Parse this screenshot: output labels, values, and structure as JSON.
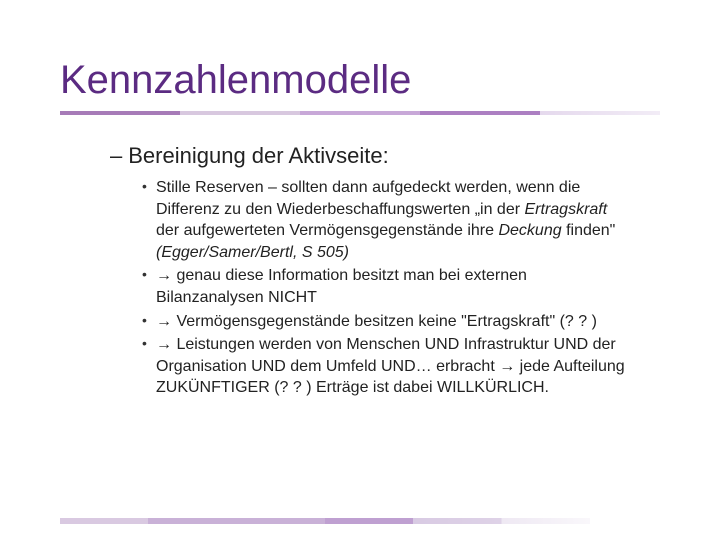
{
  "title": "Kennzahlenmodelle",
  "subheading": "Bereinigung der Aktivseite:",
  "items": [
    {
      "pre": "Stille Reserven – sollten dann aufgedeckt werden, wenn die Differenz zu den Wiederbeschaffungswerten „in der ",
      "em1": "Ertragskraft",
      "mid": " der aufgewerteten Vermögensgegenstände ihre ",
      "em2": "Deckung",
      "mid2": " finden\" ",
      "cite": "(Egger/Samer/Bertl, S 505)"
    },
    {
      "text": "→ genau diese Information besitzt man bei externen Bilanzanalysen NICHT"
    },
    {
      "text": "→ Vermögensgegenstände besitzen keine \"Ertragskraft\" (? ? )"
    },
    {
      "text": "→ Leistungen werden von Menschen UND Infrastruktur UND der Organisation UND dem Umfeld UND… erbracht → jede Aufteilung ZUKÜNFTIGER (? ? ) Erträge ist dabei WILLKÜRLICH."
    }
  ]
}
